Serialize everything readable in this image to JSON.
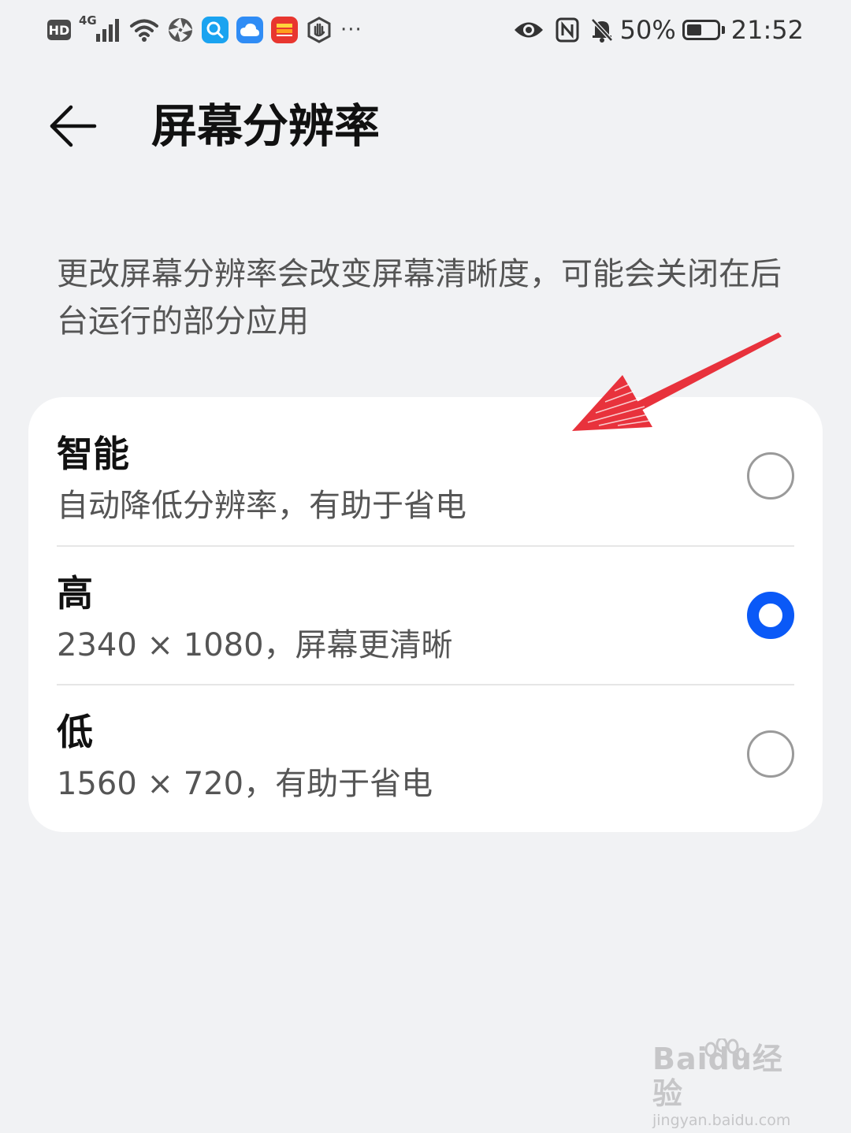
{
  "status_bar": {
    "left_badge": "HD",
    "network_type": "4G",
    "battery_percent": "50%",
    "battery_level": 0.5,
    "time": "21:52",
    "overflow": "···",
    "icons_left": [
      "hd-badge",
      "signal-icon",
      "wifi-icon",
      "aperture-icon",
      "search-app-icon",
      "cloud-app-icon",
      "news-app-icon",
      "hand-shield-icon",
      "more-notifications-icon"
    ],
    "icons_right": [
      "eye-comfort-icon",
      "nfc-icon",
      "mute-bell-icon",
      "battery-icon"
    ]
  },
  "header": {
    "title": "屏幕分辨率"
  },
  "description": "更改屏幕分辨率会改变屏幕清晰度，可能会关闭在后台运行的部分应用",
  "options": [
    {
      "title": "智能",
      "desc": "自动降低分辨率，有助于省电",
      "selected": false
    },
    {
      "title": "高",
      "desc": "2340 × 1080，屏幕更清晰",
      "selected": true
    },
    {
      "title": "低",
      "desc": "1560 × 720，有助于省电",
      "selected": false
    }
  ],
  "colors": {
    "accent": "#0a59f7",
    "background": "#f1f2f4",
    "card": "#ffffff",
    "annotation": "#e8323c"
  },
  "watermark": {
    "brand": "Baidu经验",
    "url": "jingyan.baidu.com"
  }
}
